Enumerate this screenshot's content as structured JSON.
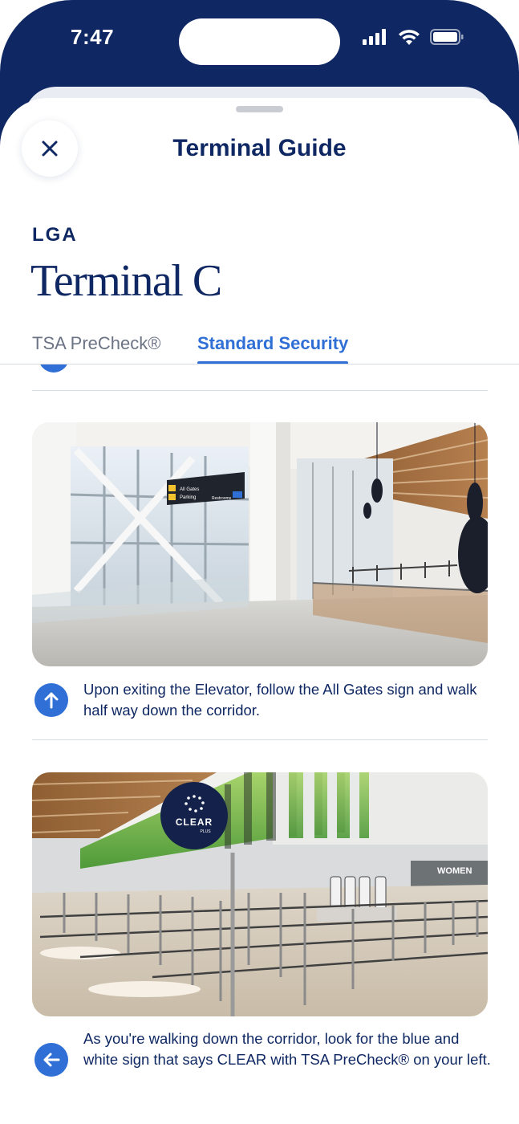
{
  "status_bar": {
    "time": "7:47",
    "icons": [
      "cellular-signal-icon",
      "wifi-icon",
      "battery-icon"
    ]
  },
  "header": {
    "title": "Terminal Guide",
    "close_icon": "close-icon"
  },
  "airport": {
    "code": "LGA",
    "terminal": "Terminal C"
  },
  "tabs": [
    {
      "label": "TSA PreCheck®",
      "selected": false
    },
    {
      "label": "Standard Security",
      "selected": true
    }
  ],
  "steps": [
    {
      "direction_icon": "arrow-up-icon",
      "text": "Upon exiting the Elevator, follow the All Gates sign and walk half way down the corridor.",
      "photo_sign": {
        "line1": "All Gates",
        "line2": "Parking",
        "line3": "Restrooms"
      }
    },
    {
      "direction_icon": "arrow-left-icon",
      "text": "As you're walking down the corridor, look for the blue and white sign that says CLEAR with TSA PreCheck® on your left.",
      "photo_sign": {
        "clear_brand": "CLEAR",
        "clear_sub": "PLUS",
        "restroom": "WOMEN"
      }
    }
  ],
  "colors": {
    "navy": "#0f2863",
    "accent_blue": "#2f6fd6",
    "muted_text": "#6b7385",
    "divider": "#d7dbe3"
  }
}
